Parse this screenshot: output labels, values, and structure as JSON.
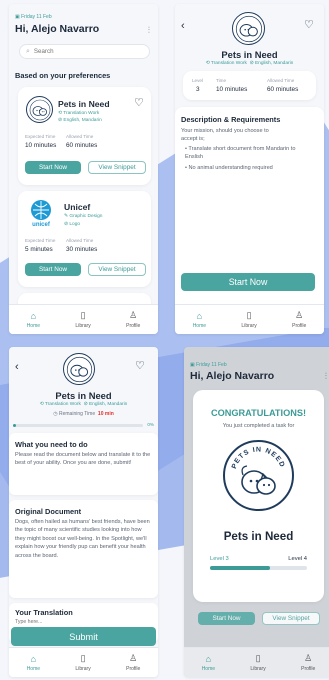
{
  "colors": {
    "accent": "#4aa5a0",
    "accent_dark": "#3c9b97",
    "progress": "#3c9b97",
    "warn": "#e0302b",
    "bg_band": "#9db6ee"
  },
  "home": {
    "date": "Friday 11 Feb",
    "greeting": "Hi, Alejo Navarro",
    "search_placeholder": "Search",
    "section": "Based on your preferences",
    "cards": [
      {
        "title": "Pets in Need",
        "tag1": "Translation Work",
        "tag2": "English, Mandarin",
        "l1": "Expected Time",
        "v1": "10 minutes",
        "l2": "Allowed Time",
        "v2": "60 minutes",
        "start": "Start Now",
        "snippet": "View Snippet"
      },
      {
        "title": "Unicef",
        "tag1": "Graphic Design",
        "tag2": "Logo",
        "logo_text": "unicef",
        "l1": "Expected Time",
        "v1": "5 minutes",
        "l2": "Allowed Time",
        "v2": "30 minutes",
        "start": "Start Now",
        "snippet": "View Snippet"
      }
    ]
  },
  "nav": {
    "home": "Home",
    "library": "Library",
    "profile": "Profile"
  },
  "detail": {
    "title": "Pets in Need",
    "tag1": "Translation Work",
    "tag2": "English, Mandarin",
    "stats": [
      {
        "label": "Level",
        "value": "3"
      },
      {
        "label": "Time",
        "value": "10 minutes"
      },
      {
        "label": "Allowed Time",
        "value": "60 minutes"
      }
    ],
    "desc_title": "Description & Requirements",
    "desc_text": "Your mission, should you choose to accept is;",
    "bullets": [
      "Translate short document from Mandarin to Enslish",
      "No animal understanding required"
    ],
    "start": "Start Now"
  },
  "task": {
    "title": "Pets in Need",
    "tag1": "Translation Work",
    "tag2": "English, Mandarin",
    "remaining_label": "Remaining Time",
    "remaining_value": "10 min",
    "progress_pct": "0%",
    "progress_value": 0,
    "need_title": "What you need to do",
    "need_text": "Please read the document below and translate it to the best of your ability. Once you are done, submit!",
    "orig_title": "Original Document",
    "orig_text": "Dogs, often hailed as humans' best friends, have been the topic of many scientific studies looking into how they might boost our well-being. In the Spotlight, we'll explain how your friendly pup can benefit your health across the board.",
    "trans_title": "Your Translation",
    "trans_placeholder": "Type here...",
    "submit": "Submit"
  },
  "congrats": {
    "date": "Friday 11 Feb",
    "greeting": "Hi, Alejo Navarro",
    "heading": "CONGRATULATIONS!",
    "sub": "You just completed a task for",
    "logo_text": "PETS IN NEED",
    "org": "Pets in Need",
    "level_from": "Level 3",
    "level_to": "Level 4",
    "level_progress": 0.62,
    "start": "Start Now",
    "snippet": "View Snippet"
  }
}
